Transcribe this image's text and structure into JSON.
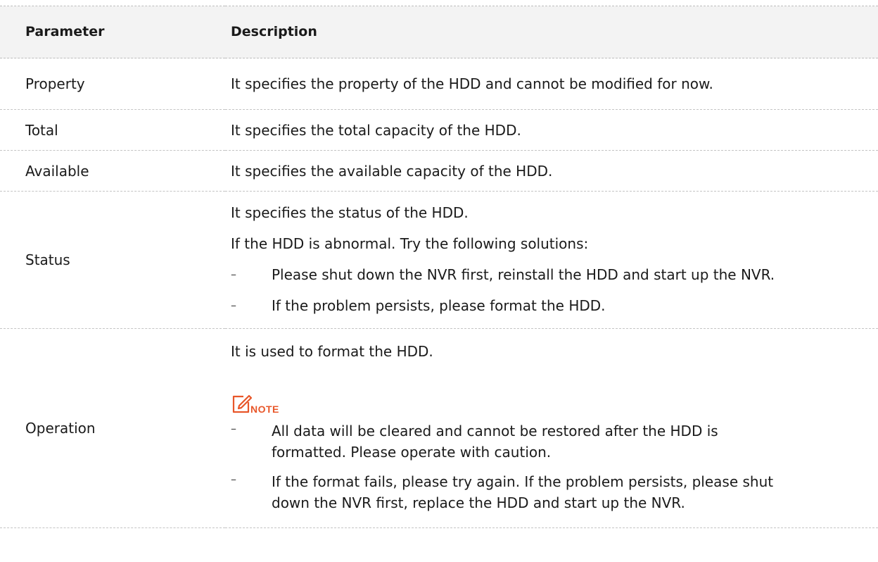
{
  "table": {
    "headers": {
      "parameter": "Parameter",
      "description": "Description"
    },
    "rows": {
      "property": {
        "parameter": "Property",
        "description": "It specifies the property of the HDD and cannot be modified for now."
      },
      "total": {
        "parameter": "Total",
        "description": "It specifies the total capacity of the HDD."
      },
      "available": {
        "parameter": "Available",
        "description": "It specifies the available capacity of the HDD."
      },
      "status": {
        "parameter": "Status",
        "lines": [
          "It specifies the status of the HDD.",
          "If the HDD is abnormal. Try the following solutions:"
        ],
        "bullet_marker": "–",
        "bullets": [
          "Please shut down the NVR first, reinstall the HDD and start up the NVR.",
          "If the problem persists, please format the HDD."
        ]
      },
      "operation": {
        "parameter": "Operation",
        "intro": "It is used to format the HDD.",
        "note_label": "NOTE",
        "note_icon": "edit-note-icon",
        "note_color": "#e8572a",
        "bullet_marker": "–",
        "bullets": [
          "All data will be cleared and cannot be restored after the HDD is formatted. Please operate with caution.",
          "If the format fails, please try again. If the problem persists, please shut down the NVR first, replace the HDD and start up the NVR."
        ]
      }
    }
  }
}
